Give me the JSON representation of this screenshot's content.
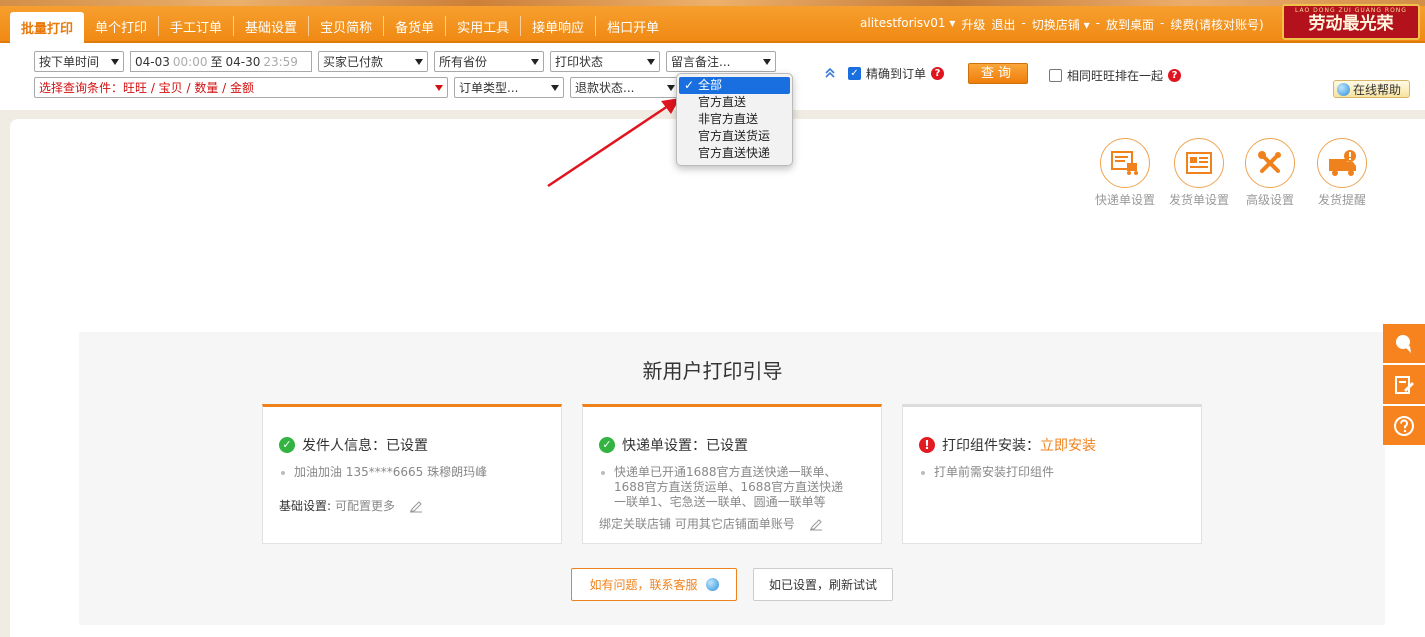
{
  "nav": {
    "items": [
      "批量打印",
      "单个打印",
      "手工订单",
      "基础设置",
      "宝贝简称",
      "备货单",
      "实用工具",
      "接单响应",
      "档口开单"
    ],
    "active_index": 0
  },
  "user_links": {
    "username": "alitestforisv01",
    "upgrade": "升级",
    "logout": "退出",
    "switch_shop": "切换店铺",
    "to_desktop": "放到桌面",
    "renew": "续费(请核对账号)"
  },
  "badge": {
    "small": "LAO DONG ZUI GUANG RONG",
    "big": "劳动最光荣"
  },
  "filters": {
    "sort_by": "按下单时间",
    "date_from": "04-03",
    "time_from": "00:00",
    "date_to_label": "至",
    "date_to": "04-30",
    "time_to": "23:59",
    "pay_status": "买家已付款",
    "province": "所有省份",
    "print_status": "打印状态",
    "remark": "留言备注...",
    "query_condition": "选择查询条件：旺旺 / 宝贝 / 数量 / 金额",
    "order_type": "订单类型...",
    "refund_status": "退款状态..."
  },
  "dropdown": {
    "options": [
      "全部",
      "官方直送",
      "非官方直送",
      "官方直送货运",
      "官方直送快递"
    ],
    "selected_index": 0
  },
  "controls": {
    "exact_order_label": "精确到订单",
    "exact_order_checked": true,
    "query_button": "查询",
    "same_wangwang_label": "相同旺旺排在一起",
    "same_wangwang_checked": false,
    "help_button": "在线帮助",
    "qmark": "?"
  },
  "tools": [
    "快递单设置",
    "发货单设置",
    "高级设置",
    "发货提醒"
  ],
  "guide": {
    "title": "新用户打印引导",
    "cards": [
      {
        "label": "发件人信息：",
        "status": "已设置",
        "bullets": [
          "加油加油 135****6665 珠穆朗玛峰"
        ],
        "footer_label": "基础设置:",
        "footer_text": "可配置更多"
      },
      {
        "label": "快递单设置：",
        "status": "已设置",
        "bullets": [
          "快递单已开通1688官方直送快递一联单、",
          "1688官方直送货运单、1688官方直送快递",
          "一联单1、宅急送一联单、圆通一联单等"
        ],
        "footer_label": "",
        "footer_text": "绑定关联店铺 可用其它店铺面单账号"
      },
      {
        "label": "打印组件安装：",
        "status": "立即安装",
        "bullets": [
          "打单前需安装打印组件"
        ]
      }
    ],
    "contact_button": "如有问题，联系客服",
    "refresh_button": "如已设置，刷新试试"
  },
  "colors": {
    "brand_orange": "#f0821d",
    "select_blue": "#1a6fe0",
    "ok_green": "#33b341",
    "warn_red": "#e21b23"
  }
}
